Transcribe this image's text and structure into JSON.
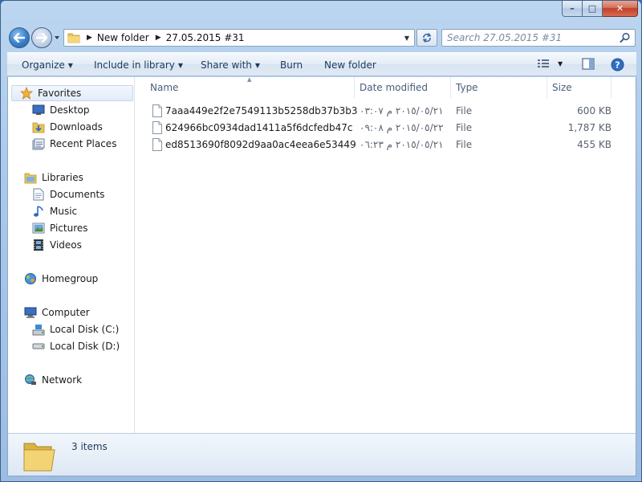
{
  "window": {
    "caption_min": "–",
    "caption_max": "□",
    "caption_close": "✕"
  },
  "address": {
    "segments": [
      "New folder",
      "27.05.2015 #31"
    ],
    "search_placeholder": "Search 27.05.2015 #31"
  },
  "toolbar": {
    "organize": "Organize",
    "include_in_library": "Include in library",
    "share_with": "Share with",
    "burn": "Burn",
    "new_folder": "New folder"
  },
  "navpane": {
    "favorites": "Favorites",
    "desktop": "Desktop",
    "downloads": "Downloads",
    "recent_places": "Recent Places",
    "libraries": "Libraries",
    "documents": "Documents",
    "music": "Music",
    "pictures": "Pictures",
    "videos": "Videos",
    "homegroup": "Homegroup",
    "computer": "Computer",
    "local_disk_c": "Local Disk (C:)",
    "local_disk_d": "Local Disk (D:)",
    "network": "Network"
  },
  "columns": {
    "name": "Name",
    "date_modified": "Date modified",
    "type": "Type",
    "size": "Size"
  },
  "files": [
    {
      "name": "7aaa449e2f2e7549113b5258db37b3b3",
      "date": "٢٠١٥/٠٥/٢١ م ٠٣:٠٧",
      "type": "File",
      "size": "600 KB"
    },
    {
      "name": "624966bc0934dad1411a5f6dcfedb47c",
      "date": "٢٠١٥/٠٥/٢٢ م ٠٩:٠٨",
      "type": "File",
      "size": "1,787 KB"
    },
    {
      "name": "ed8513690f8092d9aa0ac4eea6e53449",
      "date": "٢٠١٥/٠٥/٢١ م ٠٦:٢٣",
      "type": "File",
      "size": "455 KB"
    }
  ],
  "details": {
    "item_count": "3 items"
  }
}
